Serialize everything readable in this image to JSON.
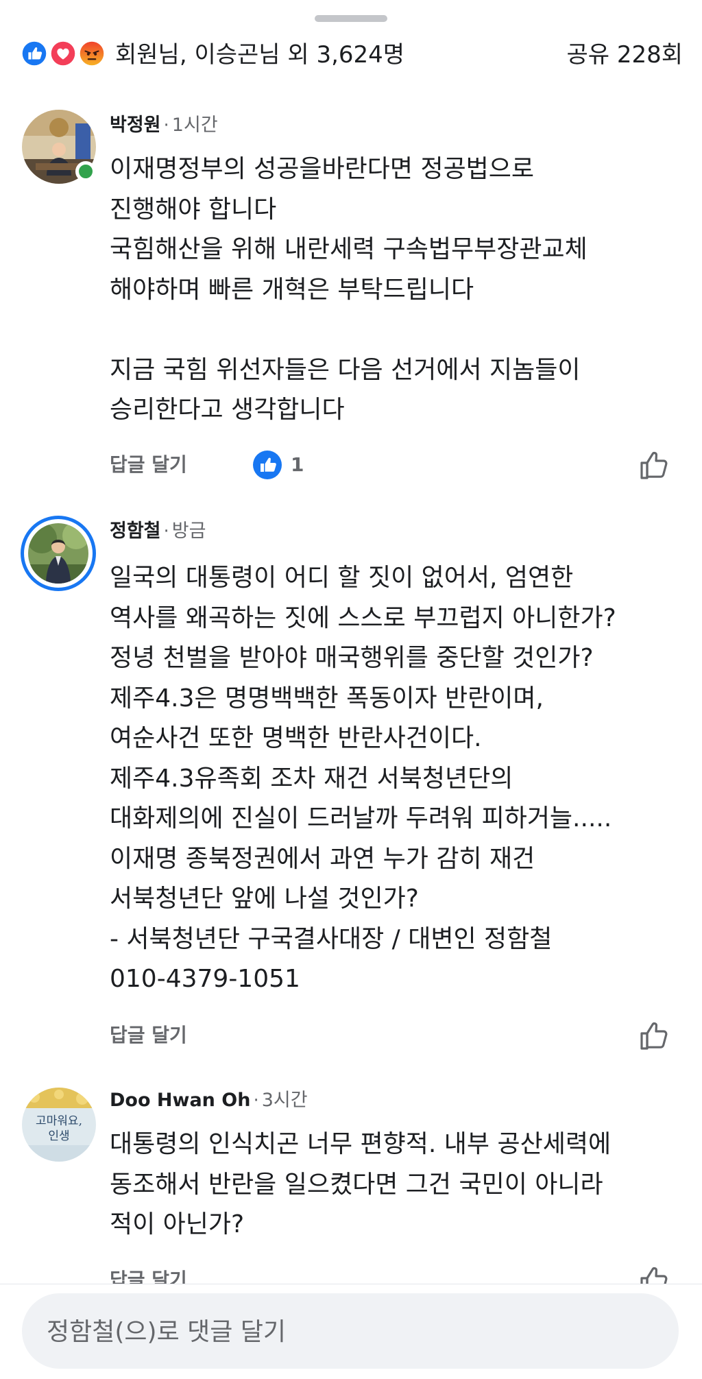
{
  "summary": {
    "reaction_icons": [
      "like-icon",
      "love-icon",
      "angry-icon"
    ],
    "text": "회원님, 이승곤님 외 3,624명",
    "share": "공유 228회"
  },
  "comments": [
    {
      "author": "박정원",
      "time": "1시간",
      "online": true,
      "lines": [
        "이재명정부의 성공을바란다면 정공법으로",
        "진행해야 합니다",
        "국힘해산을 위해 내란세력 구속법무부장관교체",
        "해야하며 빠른 개혁은 부탁드립니다",
        "",
        "지금 국힘 위선자들은 다음 선거에서 지놈들이",
        "승리한다고 생각합니다"
      ],
      "reply_label": "답글 달기",
      "reaction_count": "1"
    },
    {
      "author": "정함철",
      "time": "방금",
      "lines": [
        "일국의 대통령이 어디 할 짓이 없어서, 엄연한",
        "역사를 왜곡하는 짓에 스스로 부끄럽지 아니한가?",
        "정녕 천벌을 받아야 매국행위를 중단할 것인가?",
        "제주4.3은 명명백백한 폭동이자 반란이며,",
        "여순사건 또한 명백한 반란사건이다.",
        "제주4.3유족회 조차 재건 서북청년단의",
        "대화제의에 진실이 드러날까 두려워 피하거늘.....",
        "이재명 종북정권에서 과연 누가 감히 재건",
        "서북청년단 앞에 나설 것인가?",
        "- 서북청년단 구국결사대장 / 대변인 정함철",
        "010-4379-1051"
      ],
      "reply_label": "답글 달기"
    },
    {
      "author": "Doo Hwan Oh",
      "time": "3시간",
      "avatar_text": "고마워요, 인생",
      "lines": [
        "대통령의 인식치곤 너무 편향적. 내부 공산세력에",
        "동조해서 반란을 일으켰다면 그건 국민이 아니라",
        "적이 아닌가?"
      ],
      "reply_label": "답글 달기"
    }
  ],
  "composer": {
    "placeholder": "정함철(으)로 댓글 달기"
  },
  "colors": {
    "accent": "#1877f2",
    "secondary_text": "#65676b",
    "online": "#31a24c",
    "composer_bg": "#f0f2f5"
  }
}
